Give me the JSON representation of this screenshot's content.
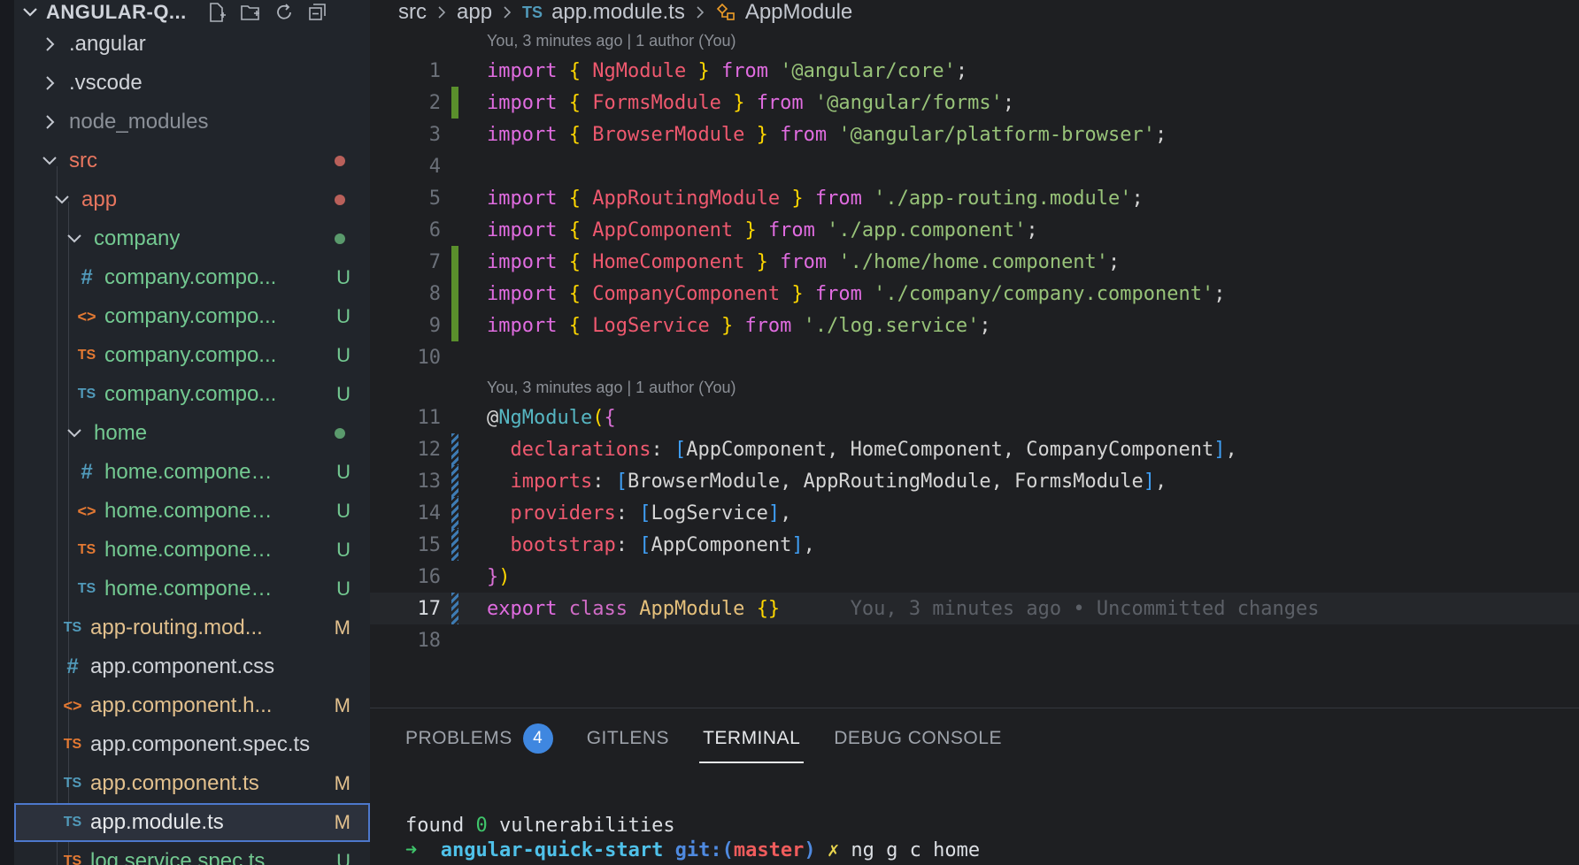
{
  "sidebar": {
    "title": "ANGULAR-Q...",
    "items": [
      {
        "label": ".angular",
        "badge": ""
      },
      {
        "label": ".vscode",
        "badge": ""
      },
      {
        "label": "node_modules",
        "badge": ""
      },
      {
        "label": "src",
        "badge": ""
      },
      {
        "label": "app",
        "badge": ""
      },
      {
        "label": "company",
        "badge": ""
      },
      {
        "label": "company.compo...",
        "badge": "U",
        "icon": "#"
      },
      {
        "label": "company.compo...",
        "badge": "U",
        "icon": "<>"
      },
      {
        "label": "company.compo...",
        "badge": "U",
        "icon": "TS"
      },
      {
        "label": "company.compo...",
        "badge": "U",
        "icon": "TS"
      },
      {
        "label": "home",
        "badge": ""
      },
      {
        "label": "home.componen...",
        "badge": "U",
        "icon": "#"
      },
      {
        "label": "home.componen...",
        "badge": "U",
        "icon": "<>"
      },
      {
        "label": "home.componen...",
        "badge": "U",
        "icon": "TS"
      },
      {
        "label": "home.componen...",
        "badge": "U",
        "icon": "TS"
      },
      {
        "label": "app-routing.mod...",
        "badge": "M",
        "icon": "TS"
      },
      {
        "label": "app.component.css",
        "badge": "",
        "icon": "#"
      },
      {
        "label": "app.component.h...",
        "badge": "M",
        "icon": "<>"
      },
      {
        "label": "app.component.spec.ts",
        "badge": "",
        "icon": "TS"
      },
      {
        "label": "app.component.ts",
        "badge": "M",
        "icon": "TS"
      },
      {
        "label": "app.module.ts",
        "badge": "M",
        "icon": "TS"
      },
      {
        "label": "log.service.spec.ts",
        "badge": "U",
        "icon": "TS"
      }
    ]
  },
  "breadcrumb": {
    "p1": "src",
    "p2": "app",
    "file_icon": "TS",
    "p3": "app.module.ts",
    "p4": "AppModule"
  },
  "editor": {
    "lens": "You, 3 minutes ago | 1 author (You)",
    "blame": "You, 3 minutes ago • Uncommitted changes",
    "line_numbers": [
      "1",
      "2",
      "3",
      "4",
      "5",
      "6",
      "7",
      "8",
      "9",
      "10",
      "11",
      "12",
      "13",
      "14",
      "15",
      "16",
      "17",
      "18"
    ],
    "tokens": {
      "import": "import",
      "from": "from",
      "export": "export",
      "class": "class",
      "lb": "{",
      "rb": "}",
      "semi": ";",
      "comma": ",",
      "NgModule": "NgModule",
      "FormsModule": "FormsModule",
      "BrowserModule": "BrowserModule",
      "AppRoutingModule": "AppRoutingModule",
      "AppComponent": "AppComponent",
      "HomeComponent": "HomeComponent",
      "CompanyComponent": "CompanyComponent",
      "LogService": "LogService",
      "AppModule": "AppModule",
      "s1": "'@angular/core'",
      "s2": "'@angular/forms'",
      "s3": "'@angular/platform-browser'",
      "s5": "'./app-routing.module'",
      "s6": "'./app.component'",
      "s7": "'./home/home.component'",
      "s8": "'./company/company.component'",
      "s9": "'./log.service'",
      "at": "@",
      "po": "(",
      "pc": ")",
      "lsq": "[",
      "rsq": "]",
      "declarations": "declarations",
      "imports": "imports",
      "providers": "providers",
      "bootstrap": "bootstrap",
      "colon": ":",
      "decl_list": "AppComponent, HomeComponent, CompanyComponent",
      "imp_list": "BrowserModule, AppRoutingModule, FormsModule",
      "prov_list": "LogService",
      "boot_list": "AppComponent",
      "empty": "{}"
    }
  },
  "panel": {
    "tabs": [
      "PROBLEMS",
      "GITLENS",
      "TERMINAL",
      "DEBUG CONSOLE"
    ],
    "problems_count": "4",
    "terminal": {
      "l1a": "found ",
      "l1b": "0",
      "l1c": " vulnerabilities",
      "arrow": "➜",
      "dir": "angular-quick-start",
      "git": "git:(",
      "branch": "master",
      "gitclose": ")",
      "x": "✗",
      "cmd": "ng g c home"
    }
  },
  "colors": {
    "accent": "#3f87e0",
    "added": "#5a8f2c",
    "modified": "#3e7bb3",
    "untracked": "#73c991",
    "modified_file": "#e2c08d"
  }
}
